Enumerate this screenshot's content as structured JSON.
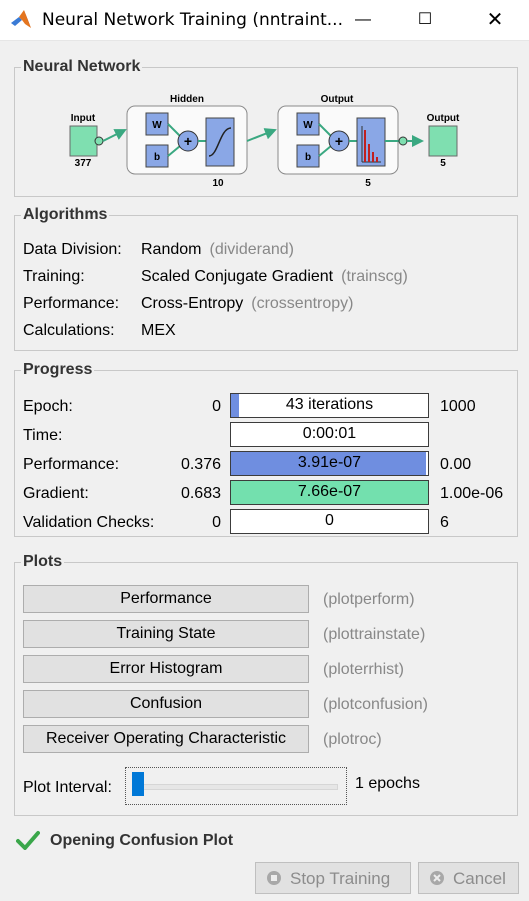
{
  "window": {
    "title": "Neural Network Training (nntraint...",
    "minimize_glyph": "—",
    "maximize_glyph": "☐",
    "close_glyph": "✕"
  },
  "network": {
    "title": "Neural Network",
    "input": {
      "label": "Input",
      "size": "377"
    },
    "hidden": {
      "label": "Hidden",
      "size": "10",
      "weight": "W",
      "bias": "b"
    },
    "output_layer": {
      "label": "Output",
      "size": "5",
      "weight": "W",
      "bias": "b"
    },
    "output": {
      "label": "Output",
      "size": "5"
    }
  },
  "algorithms": {
    "title": "Algorithms",
    "rows": [
      {
        "label": "Data Division:",
        "value": "Random",
        "fn": "(dividerand)"
      },
      {
        "label": "Training:",
        "value": "Scaled Conjugate Gradient",
        "fn": "(trainscg)"
      },
      {
        "label": "Performance:",
        "value": "Cross-Entropy",
        "fn": "(crossentropy)"
      },
      {
        "label": "Calculations:",
        "value": "MEX",
        "fn": ""
      }
    ]
  },
  "progress": {
    "title": "Progress",
    "rows": [
      {
        "label": "Epoch:",
        "start": "0",
        "value": "43 iterations",
        "end": "1000",
        "fill": 0.043,
        "fill_color": "#6f8ee0"
      },
      {
        "label": "Time:",
        "start": "",
        "value": "0:00:01",
        "end": "",
        "fill": 0,
        "fill_color": "#6f8ee0"
      },
      {
        "label": "Performance:",
        "start": "0.376",
        "value": "3.91e-07",
        "end": "0.00",
        "fill": 0.99,
        "fill_color": "#6f8ee0"
      },
      {
        "label": "Gradient:",
        "start": "0.683",
        "value": "7.66e-07",
        "end": "1.00e-06",
        "fill": 1.0,
        "fill_color": "#73e0ae"
      },
      {
        "label": "Validation Checks:",
        "start": "0",
        "value": "0",
        "end": "6",
        "fill": 0,
        "fill_color": "#6f8ee0"
      }
    ]
  },
  "plots": {
    "title": "Plots",
    "buttons": [
      {
        "label": "Performance",
        "fn": "(plotperform)"
      },
      {
        "label": "Training State",
        "fn": "(plottrainstate)"
      },
      {
        "label": "Error Histogram",
        "fn": "(ploterrhist)"
      },
      {
        "label": "Confusion",
        "fn": "(plotconfusion)"
      },
      {
        "label": "Receiver Operating Characteristic",
        "fn": "(plotroc)"
      }
    ],
    "interval_label": "Plot Interval:",
    "interval_value": "1 epochs"
  },
  "status": {
    "message": "Opening Confusion Plot",
    "icon": "check-icon"
  },
  "footer": {
    "stop_label": "Stop Training",
    "cancel_label": "Cancel"
  }
}
